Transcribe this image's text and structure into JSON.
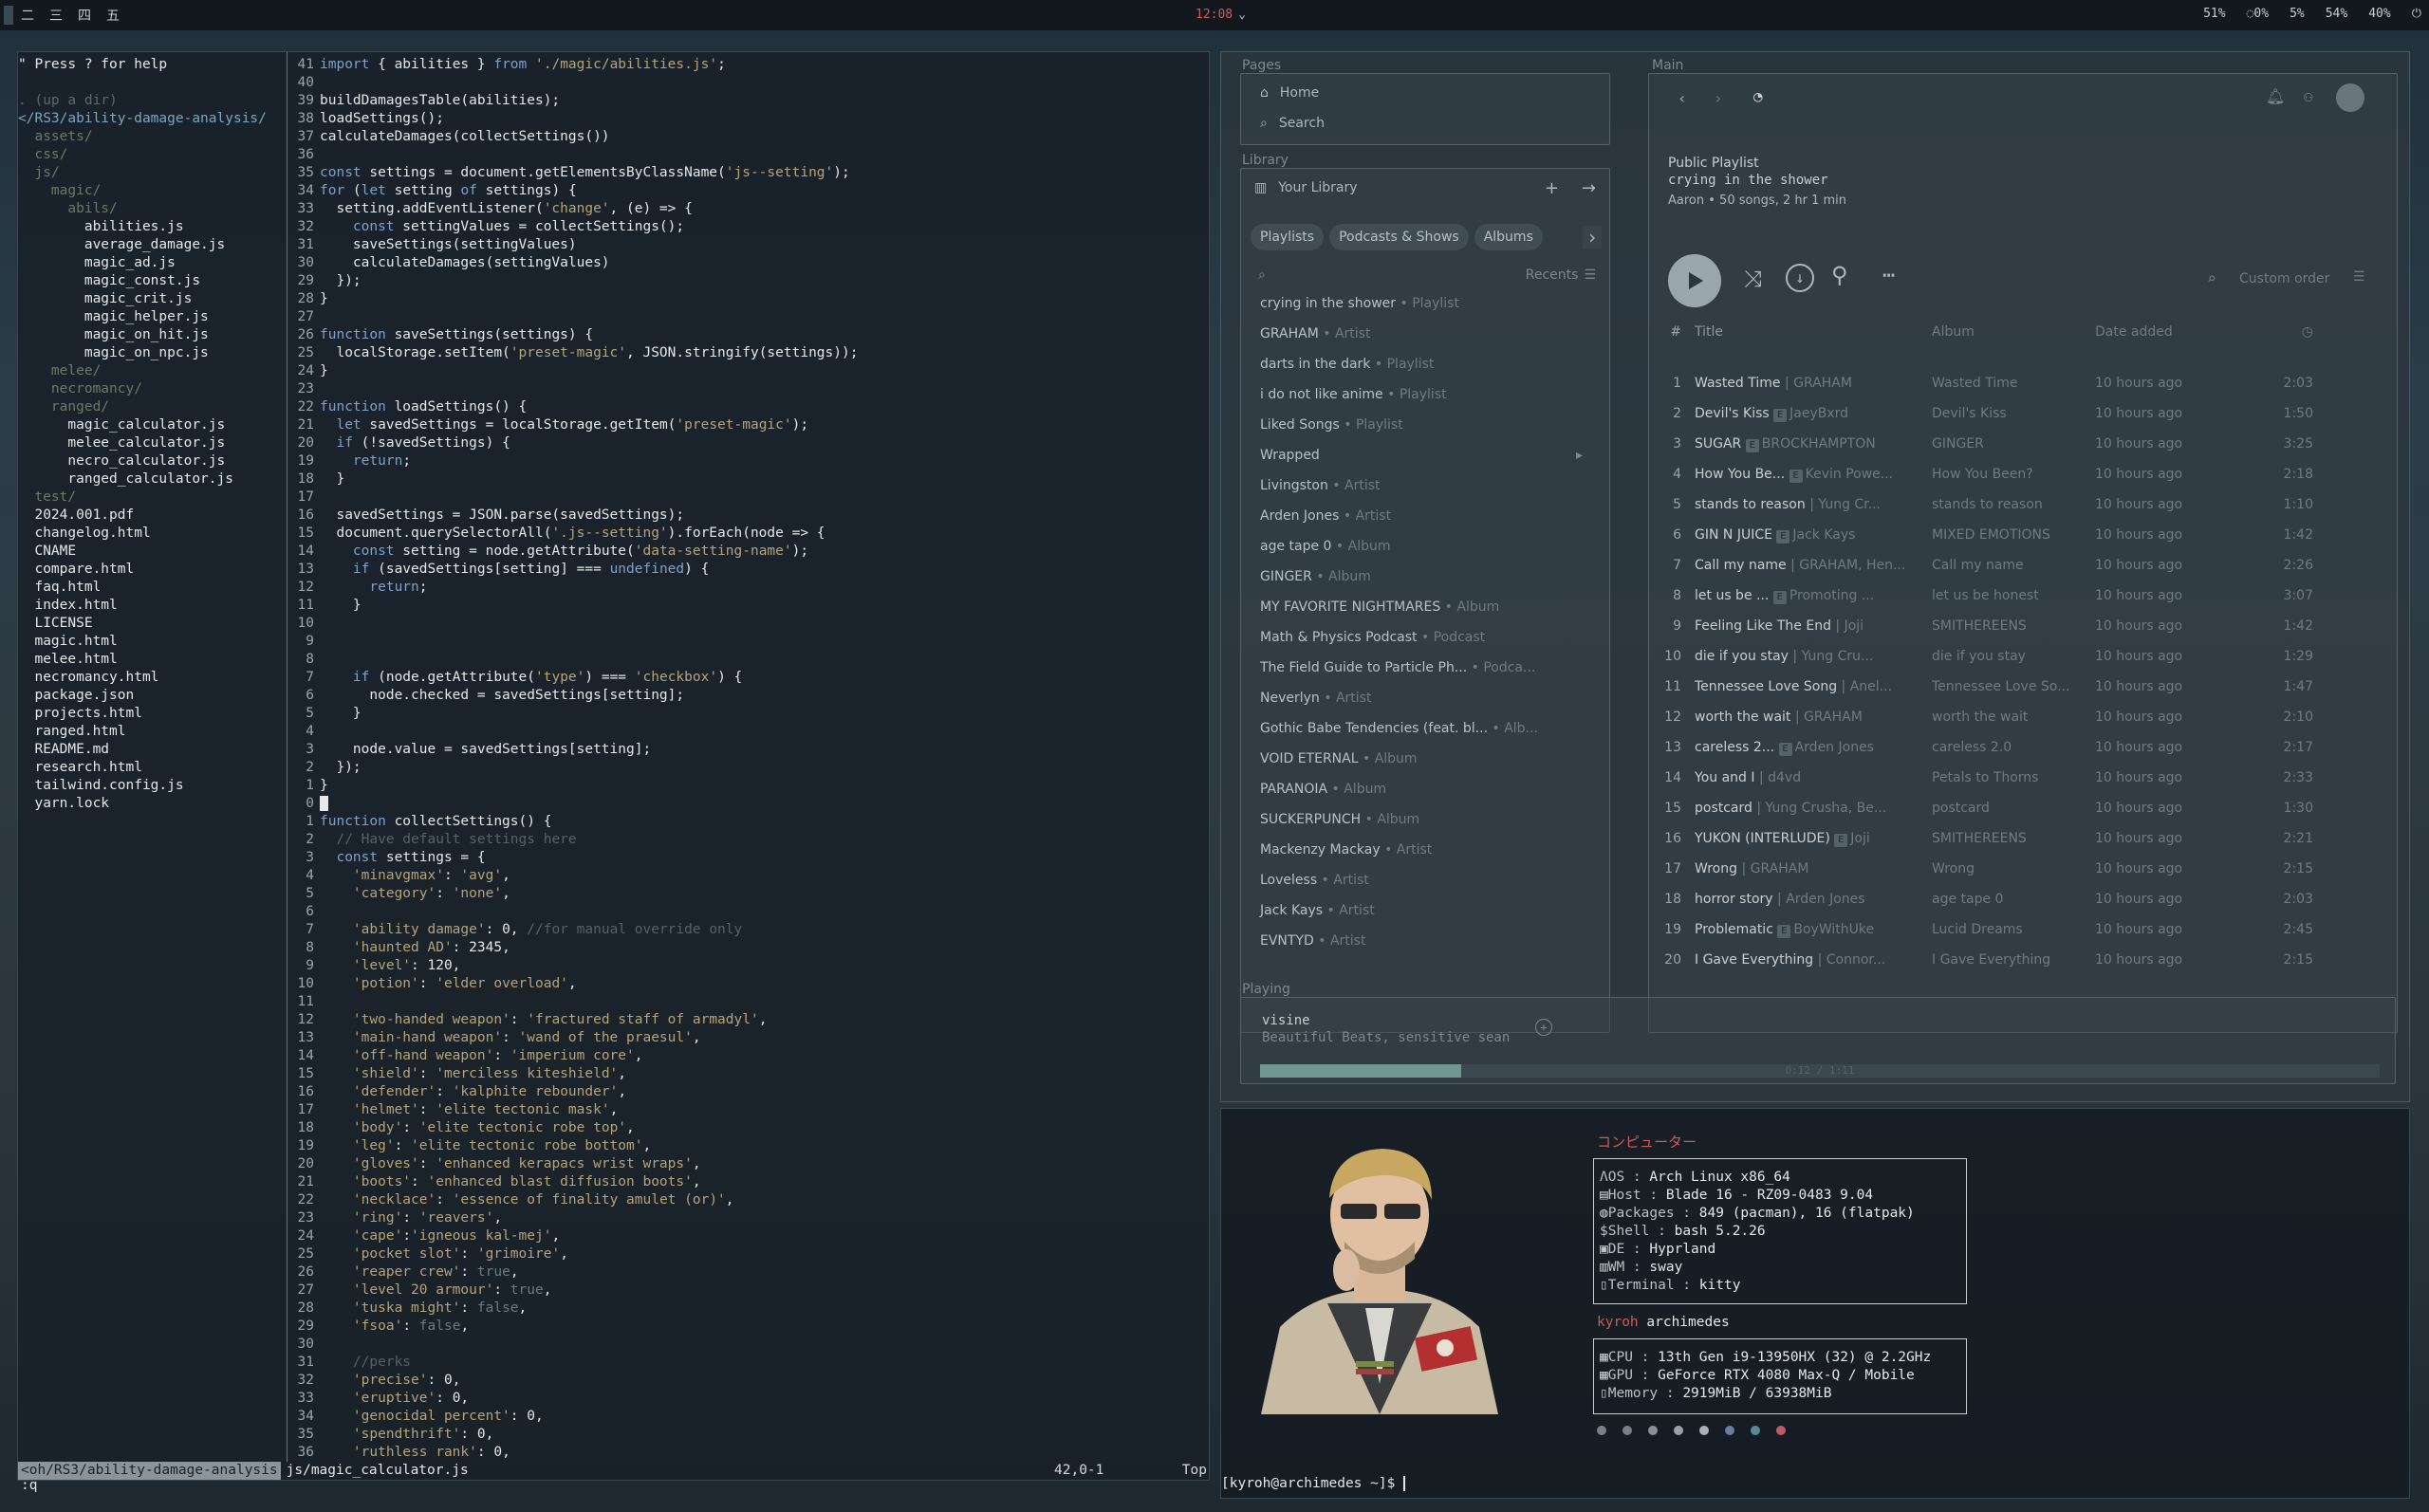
{
  "topbar": {
    "workspaces": [
      "二",
      "三",
      "四",
      "五"
    ],
    "clock": "12:08",
    "clock_arrow": "⌄",
    "status": [
      "51%",
      "◌0%",
      "5%",
      "54%",
      "40%",
      "⏻"
    ]
  },
  "editor": {
    "tree": [
      {
        "t": "\" Press ? for help",
        "c": "ct"
      },
      {
        "t": "",
        "c": "ct"
      },
      {
        "t": ". (up a dir)",
        "c": "dim"
      },
      {
        "t": "</RS3/ability-damage-analysis/",
        "c": "path"
      },
      {
        "t": "  assets/",
        "c": "dir"
      },
      {
        "t": "  css/",
        "c": "dir"
      },
      {
        "t": "  js/",
        "c": "dir"
      },
      {
        "t": "    magic/",
        "c": "dir"
      },
      {
        "t": "      abils/",
        "c": "dir"
      },
      {
        "t": "        abilities.js",
        "c": "ct"
      },
      {
        "t": "        average_damage.js",
        "c": "ct"
      },
      {
        "t": "        magic_ad.js",
        "c": "ct"
      },
      {
        "t": "        magic_const.js",
        "c": "ct"
      },
      {
        "t": "        magic_crit.js",
        "c": "ct"
      },
      {
        "t": "        magic_helper.js",
        "c": "ct"
      },
      {
        "t": "        magic_on_hit.js",
        "c": "ct"
      },
      {
        "t": "        magic_on_npc.js",
        "c": "ct"
      },
      {
        "t": "    melee/",
        "c": "dir"
      },
      {
        "t": "    necromancy/",
        "c": "dir"
      },
      {
        "t": "    ranged/",
        "c": "dir"
      },
      {
        "t": "      magic_calculator.js",
        "c": "ct"
      },
      {
        "t": "      melee_calculator.js",
        "c": "ct"
      },
      {
        "t": "      necro_calculator.js",
        "c": "ct"
      },
      {
        "t": "      ranged_calculator.js",
        "c": "ct"
      },
      {
        "t": "  test/",
        "c": "dir"
      },
      {
        "t": "  2024.001.pdf",
        "c": "ct"
      },
      {
        "t": "  changelog.html",
        "c": "ct"
      },
      {
        "t": "  CNAME",
        "c": "ct"
      },
      {
        "t": "  compare.html",
        "c": "ct"
      },
      {
        "t": "  faq.html",
        "c": "ct"
      },
      {
        "t": "  index.html",
        "c": "ct"
      },
      {
        "t": "  LICENSE",
        "c": "ct"
      },
      {
        "t": "  magic.html",
        "c": "ct"
      },
      {
        "t": "  melee.html",
        "c": "ct"
      },
      {
        "t": "  necromancy.html",
        "c": "ct"
      },
      {
        "t": "  package.json",
        "c": "ct"
      },
      {
        "t": "  projects.html",
        "c": "ct"
      },
      {
        "t": "  ranged.html",
        "c": "ct"
      },
      {
        "t": "  README.md",
        "c": "ct"
      },
      {
        "t": "  research.html",
        "c": "ct"
      },
      {
        "t": "  tailwind.config.js",
        "c": "ct"
      },
      {
        "t": "  yarn.lock",
        "c": "ct"
      }
    ],
    "code": [
      [
        "41",
        "import { abilities } from './magic/abilities.js';"
      ],
      [
        "40",
        ""
      ],
      [
        "39",
        "buildDamagesTable(abilities);"
      ],
      [
        "38",
        "loadSettings();"
      ],
      [
        "37",
        "calculateDamages(collectSettings())"
      ],
      [
        "36",
        ""
      ],
      [
        "35",
        "const settings = document.getElementsByClassName('js--setting');"
      ],
      [
        "34",
        "for (let setting of settings) {"
      ],
      [
        "33",
        "  setting.addEventListener('change', (e) => {"
      ],
      [
        "32",
        "    const settingValues = collectSettings();"
      ],
      [
        "31",
        "    saveSettings(settingValues)"
      ],
      [
        "30",
        "    calculateDamages(settingValues)"
      ],
      [
        "29",
        "  });"
      ],
      [
        "28",
        "}"
      ],
      [
        "27",
        ""
      ],
      [
        "26",
        "function saveSettings(settings) {"
      ],
      [
        "25",
        "  localStorage.setItem('preset-magic', JSON.stringify(settings));"
      ],
      [
        "24",
        "}"
      ],
      [
        "23",
        ""
      ],
      [
        "22",
        "function loadSettings() {"
      ],
      [
        "21",
        "  let savedSettings = localStorage.getItem('preset-magic');"
      ],
      [
        "20",
        "  if (!savedSettings) {"
      ],
      [
        "19",
        "    return;"
      ],
      [
        "18",
        "  }"
      ],
      [
        "17",
        ""
      ],
      [
        "16",
        "  savedSettings = JSON.parse(savedSettings);"
      ],
      [
        "15",
        "  document.querySelectorAll('.js--setting').forEach(node => {"
      ],
      [
        "14",
        "    const setting = node.getAttribute('data-setting-name');"
      ],
      [
        "13",
        "    if (savedSettings[setting] === undefined) {"
      ],
      [
        "12",
        "      return;"
      ],
      [
        "11",
        "    }"
      ],
      [
        "10",
        ""
      ],
      [
        "9",
        ""
      ],
      [
        "8",
        ""
      ],
      [
        "7",
        "    if (node.getAttribute('type') === 'checkbox') {"
      ],
      [
        "6",
        "      node.checked = savedSettings[setting];"
      ],
      [
        "5",
        "    }"
      ],
      [
        "4",
        ""
      ],
      [
        "3",
        "    node.value = savedSettings[setting];"
      ],
      [
        "2",
        "  });"
      ],
      [
        "1",
        "}"
      ],
      [
        "0",
        ""
      ],
      [
        "1",
        "function collectSettings() {"
      ],
      [
        "2",
        "  // Have default settings here"
      ],
      [
        "3",
        "  const settings = {"
      ],
      [
        "4",
        "    'minavgmax': 'avg',"
      ],
      [
        "5",
        "    'category': 'none',"
      ],
      [
        "6",
        ""
      ],
      [
        "7",
        "    'ability damage': 0, //for manual override only"
      ],
      [
        "8",
        "    'haunted AD': 2345,"
      ],
      [
        "9",
        "    'level': 120,"
      ],
      [
        "10",
        "    'potion': 'elder overload',"
      ],
      [
        "11",
        ""
      ],
      [
        "12",
        "    'two-handed weapon': 'fractured staff of armadyl',"
      ],
      [
        "13",
        "    'main-hand weapon': 'wand of the praesul',"
      ],
      [
        "14",
        "    'off-hand weapon': 'imperium core',"
      ],
      [
        "15",
        "    'shield': 'merciless kiteshield',"
      ],
      [
        "16",
        "    'defender': 'kalphite rebounder',"
      ],
      [
        "17",
        "    'helmet': 'elite tectonic mask',"
      ],
      [
        "18",
        "    'body': 'elite tectonic robe top',"
      ],
      [
        "19",
        "    'leg': 'elite tectonic robe bottom',"
      ],
      [
        "20",
        "    'gloves': 'enhanced kerapacs wrist wraps',"
      ],
      [
        "21",
        "    'boots': 'enhanced blast diffusion boots',"
      ],
      [
        "22",
        "    'necklace': 'essence of finality amulet (or)',"
      ],
      [
        "23",
        "    'ring': 'reavers',"
      ],
      [
        "24",
        "    'cape':'igneous kal-mej',"
      ],
      [
        "25",
        "    'pocket slot': 'grimoire',"
      ],
      [
        "26",
        "    'reaper crew': true,"
      ],
      [
        "27",
        "    'level 20 armour': true,"
      ],
      [
        "28",
        "    'tuska might': false,"
      ],
      [
        "29",
        "    'fsoa': false,"
      ],
      [
        "30",
        ""
      ],
      [
        "31",
        "    //perks"
      ],
      [
        "32",
        "    'precise': 0,"
      ],
      [
        "33",
        "    'eruptive': 0,"
      ],
      [
        "34",
        "    'genocidal percent': 0,"
      ],
      [
        "35",
        "    'spendthrift': 0,"
      ],
      [
        "36",
        "    'ruthless rank': 0,"
      ]
    ],
    "statusline": {
      "left": "<oh/RS3/ability-damage-analysis",
      "file": "js/magic_calculator.js",
      "pos": "42,0-1",
      "top": "Top"
    },
    "cmdline": ":q"
  },
  "spotify": {
    "pages_label": "Pages",
    "main_label": "Main",
    "library_label": "Library",
    "playing_label": "Playing",
    "nav": {
      "home": "Home",
      "search": "Search"
    },
    "your_library": "Your Library",
    "filters": [
      "Playlists",
      "Podcasts & Shows",
      "Albums"
    ],
    "recents_label": "Recents",
    "library_items": [
      {
        "name": "crying in the shower",
        "meta": "Playlist"
      },
      {
        "name": "GRAHAM",
        "meta": "Artist"
      },
      {
        "name": "darts in the dark",
        "meta": "Playlist"
      },
      {
        "name": "i do not like anime",
        "meta": "Playlist"
      },
      {
        "name": "Liked Songs",
        "meta": "Playlist"
      },
      {
        "name": "Wrapped",
        "meta": ""
      },
      {
        "name": "Livingston",
        "meta": "Artist"
      },
      {
        "name": "Arden Jones",
        "meta": "Artist"
      },
      {
        "name": "age tape 0",
        "meta": "Album"
      },
      {
        "name": "GINGER",
        "meta": "Album"
      },
      {
        "name": "MY FAVORITE NIGHTMARES",
        "meta": "Album"
      },
      {
        "name": "Math & Physics Podcast",
        "meta": "Podcast"
      },
      {
        "name": "The Field Guide to Particle Ph...",
        "meta": "Podca..."
      },
      {
        "name": "Neverlyn",
        "meta": "Artist"
      },
      {
        "name": "Gothic Babe Tendencies (feat. bl...",
        "meta": "Alb..."
      },
      {
        "name": "VOID ETERNAL",
        "meta": "Album"
      },
      {
        "name": "PARANOIA",
        "meta": "Album"
      },
      {
        "name": "SUCKERPUNCH",
        "meta": "Album"
      },
      {
        "name": "Mackenzy Mackay",
        "meta": "Artist"
      },
      {
        "name": "Loveless",
        "meta": "Artist"
      },
      {
        "name": "Jack Kays",
        "meta": "Artist"
      },
      {
        "name": "EVNTYD",
        "meta": "Artist"
      }
    ],
    "playlist": {
      "type": "Public Playlist",
      "name": "crying in the shower",
      "info": "Aaron • 50 songs, 2 hr 1 min"
    },
    "custom_order": "Custom order",
    "columns": {
      "num": "#",
      "title": "Title",
      "album": "Album",
      "date": "Date added"
    },
    "tracks": [
      {
        "n": "1",
        "title": "Wasted Time",
        "artist": "GRAHAM",
        "e": false,
        "album": "Wasted Time",
        "date": "10 hours ago",
        "dur": "2:03"
      },
      {
        "n": "2",
        "title": "Devil's Kiss",
        "artist": "JaeyBxrd",
        "e": true,
        "album": "Devil's Kiss",
        "date": "10 hours ago",
        "dur": "1:50"
      },
      {
        "n": "3",
        "title": "SUGAR",
        "artist": "BROCKHAMPTON",
        "e": true,
        "album": "GINGER",
        "date": "10 hours ago",
        "dur": "3:25"
      },
      {
        "n": "4",
        "title": "How You Be...",
        "artist": "Kevin Powe...",
        "e": true,
        "album": "How You Been?",
        "date": "10 hours ago",
        "dur": "2:18"
      },
      {
        "n": "5",
        "title": "stands to reason",
        "artist": "Yung Cr...",
        "e": false,
        "album": "stands to reason",
        "date": "10 hours ago",
        "dur": "1:10"
      },
      {
        "n": "6",
        "title": "GIN N JUICE",
        "artist": "Jack Kays",
        "e": true,
        "album": "MIXED EMOTIONS",
        "date": "10 hours ago",
        "dur": "1:42"
      },
      {
        "n": "7",
        "title": "Call my name",
        "artist": "GRAHAM, Hen...",
        "e": false,
        "album": "Call my name",
        "date": "10 hours ago",
        "dur": "2:26"
      },
      {
        "n": "8",
        "title": "let us be ...",
        "artist": "Promoting ...",
        "e": true,
        "album": "let us be honest",
        "date": "10 hours ago",
        "dur": "3:07"
      },
      {
        "n": "9",
        "title": "Feeling Like The End",
        "artist": "Joji",
        "e": false,
        "album": "SMITHEREENS",
        "date": "10 hours ago",
        "dur": "1:42"
      },
      {
        "n": "10",
        "title": "die if you stay",
        "artist": "Yung Cru...",
        "e": false,
        "album": "die if you stay",
        "date": "10 hours ago",
        "dur": "1:29"
      },
      {
        "n": "11",
        "title": "Tennessee Love Song",
        "artist": "Anel...",
        "e": false,
        "album": "Tennessee Love So...",
        "date": "10 hours ago",
        "dur": "1:47"
      },
      {
        "n": "12",
        "title": "worth the wait",
        "artist": "GRAHAM",
        "e": false,
        "album": "worth the wait",
        "date": "10 hours ago",
        "dur": "2:10"
      },
      {
        "n": "13",
        "title": "careless 2...",
        "artist": "Arden Jones",
        "e": true,
        "album": "careless 2.0",
        "date": "10 hours ago",
        "dur": "2:17"
      },
      {
        "n": "14",
        "title": "You and I",
        "artist": "d4vd",
        "e": false,
        "album": "Petals to Thorns",
        "date": "10 hours ago",
        "dur": "2:33"
      },
      {
        "n": "15",
        "title": "postcard",
        "artist": "Yung Crusha, Be...",
        "e": false,
        "album": "postcard",
        "date": "10 hours ago",
        "dur": "1:30"
      },
      {
        "n": "16",
        "title": "YUKON (INTERLUDE)",
        "artist": "Joji",
        "e": true,
        "album": "SMITHEREENS",
        "date": "10 hours ago",
        "dur": "2:21"
      },
      {
        "n": "17",
        "title": "Wrong",
        "artist": "GRAHAM",
        "e": false,
        "album": "Wrong",
        "date": "10 hours ago",
        "dur": "2:15"
      },
      {
        "n": "18",
        "title": "horror story",
        "artist": "Arden Jones",
        "e": false,
        "album": "age tape 0",
        "date": "10 hours ago",
        "dur": "2:03"
      },
      {
        "n": "19",
        "title": "Problematic",
        "artist": "BoyWithUke",
        "e": true,
        "album": "Lucid Dreams",
        "date": "10 hours ago",
        "dur": "2:45"
      },
      {
        "n": "20",
        "title": "I Gave Everything",
        "artist": "Connor...",
        "e": false,
        "album": "I Gave Everything",
        "date": "10 hours ago",
        "dur": "2:15"
      }
    ],
    "now_playing": {
      "title": "visine",
      "artist": "Beautiful Beats, sensitive sean",
      "time": "0:12 / 1:11",
      "progress": 0.18
    }
  },
  "fetch": {
    "header": "コンピューター",
    "rows1": [
      {
        "icon": "Λ",
        "key": "OS",
        "val": "Arch Linux x86_64"
      },
      {
        "icon": "▤",
        "key": "Host",
        "val": "Blade 16 - RZ09-0483 9.04"
      },
      {
        "icon": "◍",
        "key": "Packages",
        "val": "849 (pacman), 16 (flatpak)"
      },
      {
        "icon": "$",
        "key": "Shell",
        "val": "bash 5.2.26"
      },
      {
        "icon": "▣",
        "key": "DE",
        "val": "Hyprland"
      },
      {
        "icon": "▥",
        "key": "WM",
        "val": "sway"
      },
      {
        "icon": "▯",
        "key": "Terminal",
        "val": "kitty"
      }
    ],
    "user": "kyroh",
    "hostname": "archimedes",
    "rows2": [
      {
        "icon": "▦",
        "key": "CPU",
        "val": "13th Gen i9-13950HX (32) @ 2.2GHz"
      },
      {
        "icon": "▦",
        "key": "GPU",
        "val": "GeForce RTX 4080 Max-Q / Mobile"
      },
      {
        "icon": "▯",
        "key": "Memory",
        "val": "2919MiB / 63938MiB"
      }
    ],
    "dot_colors": [
      "#7a8088",
      "#7a8088",
      "#8a9098",
      "#9aa0a8",
      "#aab0b8",
      "#6a7ea0",
      "#5a8a98",
      "#c05a6a"
    ],
    "prompt": "[kyroh@archimedes ~]$ "
  }
}
